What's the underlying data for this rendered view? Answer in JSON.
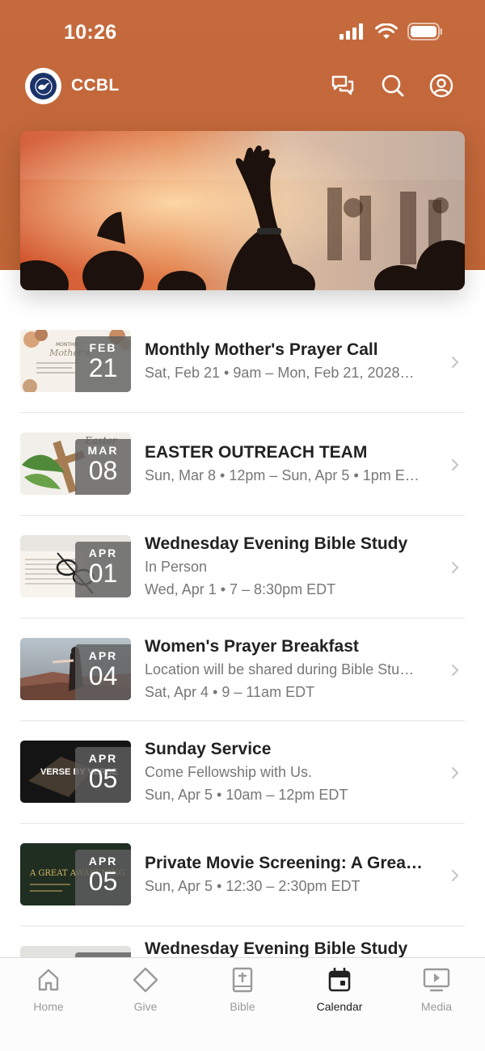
{
  "status": {
    "time": "10:26"
  },
  "header": {
    "brand": "CCBL"
  },
  "icons": {
    "messages": "chat-bubbles-icon",
    "search": "search-icon",
    "account": "user-icon"
  },
  "events": [
    {
      "month": "FEB",
      "day": "21",
      "title": "Monthly Mother's Prayer Call",
      "lines": [
        "Sat, Feb 21 • 9am – Mon, Feb 21, 2028…"
      ]
    },
    {
      "month": "MAR",
      "day": "08",
      "title": "EASTER OUTREACH TEAM",
      "lines": [
        "Sun, Mar 8 • 12pm – Sun, Apr 5 • 1pm E…"
      ]
    },
    {
      "month": "APR",
      "day": "01",
      "title": "Wednesday Evening Bible Study",
      "lines": [
        "In Person",
        "Wed, Apr 1 • 7 – 8:30pm EDT"
      ]
    },
    {
      "month": "APR",
      "day": "04",
      "title": "Women's Prayer Breakfast",
      "lines": [
        "Location will be shared during Bible Stu…",
        "Sat, Apr 4 • 9 – 11am EDT"
      ]
    },
    {
      "month": "APR",
      "day": "05",
      "title": "Sunday Service",
      "lines": [
        "Come Fellowship with Us.",
        "Sun, Apr 5 • 10am – 12pm EDT"
      ],
      "thumb_text": "VERSE BY VERSE"
    },
    {
      "month": "APR",
      "day": "05",
      "title": "Private Movie Screening: A Grea…",
      "lines": [
        "Sun, Apr 5 • 12:30 – 2:30pm EDT"
      ],
      "thumb_text": "A GREAT AWAKENING"
    },
    {
      "month": "",
      "day": "",
      "title": "Wednesday Evening Bible Study",
      "lines": []
    }
  ],
  "tabs": [
    {
      "label": "Home",
      "icon": "home-icon"
    },
    {
      "label": "Give",
      "icon": "diamond-icon"
    },
    {
      "label": "Bible",
      "icon": "bible-icon"
    },
    {
      "label": "Calendar",
      "icon": "calendar-icon",
      "active": true
    },
    {
      "label": "Media",
      "icon": "media-play-icon"
    }
  ],
  "colors": {
    "header": "#c56a3c",
    "active_tab": "#222222",
    "inactive_tab": "#9a9a9a"
  }
}
